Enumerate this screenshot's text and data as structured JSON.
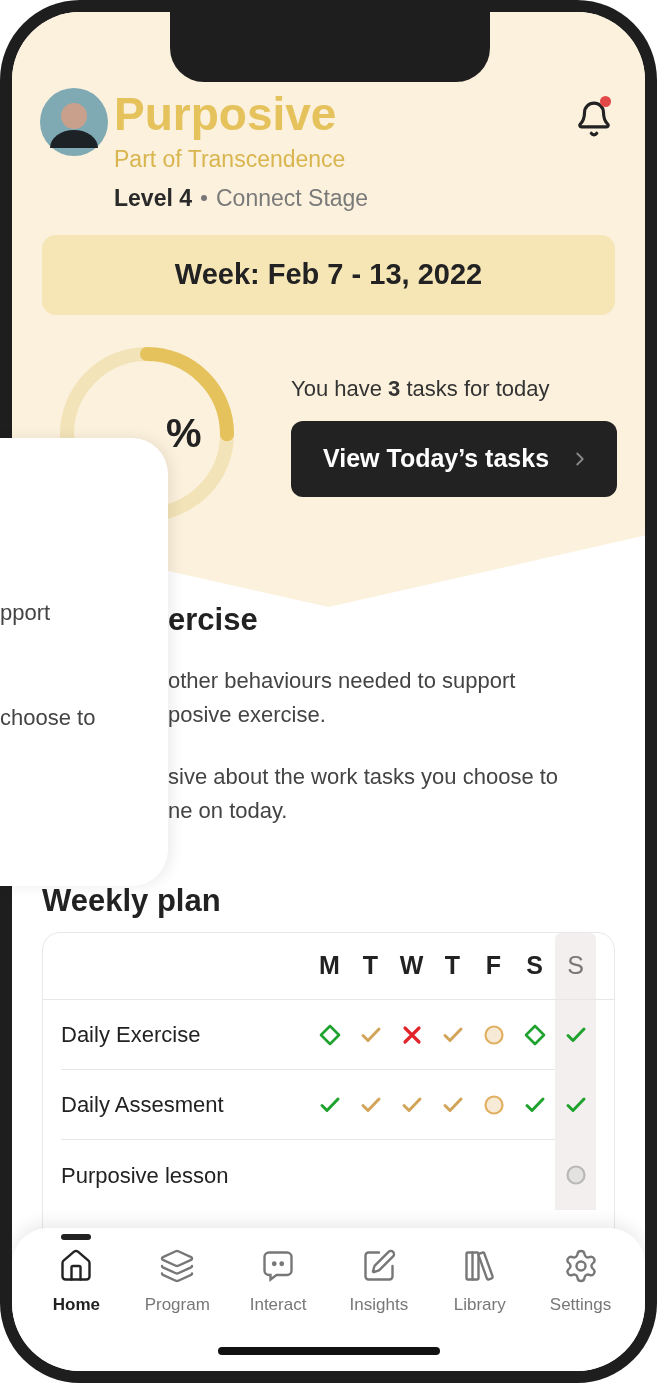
{
  "header": {
    "title": "Purposive",
    "subtitle": "Part of Transcendence",
    "level": "Level 4",
    "stage": "Connect Stage",
    "notification": true
  },
  "week": "Week: Feb 7 - 13, 2022",
  "progress": {
    "level": 0.25,
    "text": "%"
  },
  "tasks": {
    "text": "You have **3** tasks for today",
    "button": "View Today’s tasks"
  },
  "exercise": {
    "heading": "ercise",
    "paragraphs": [
      "other behaviours needed to support",
      "posive exercise.",
      "sive about the work tasks you choose to",
      "ne on today."
    ]
  },
  "overlay_card": {
    "lines": [
      "pport",
      "choose to"
    ]
  },
  "weekly_plan": {
    "heading": "Weekly plan",
    "days": [
      {
        "label": "M",
        "selected": false
      },
      {
        "label": "T",
        "selected": false
      },
      {
        "label": "W",
        "selected": false
      },
      {
        "label": "T",
        "selected": false
      },
      {
        "label": "F",
        "selected": false
      },
      {
        "label": "S",
        "selected": false
      },
      {
        "label": "S",
        "selected": true
      }
    ],
    "rows": [
      {
        "label": "Daily Exercise",
        "marks": [
          {
            "kind": "diamond",
            "color": "#1fa32e"
          },
          {
            "kind": "check",
            "color": "#d2a45a"
          },
          {
            "kind": "cross",
            "color": "#e0252b"
          },
          {
            "kind": "check",
            "color": "#d2a45a"
          },
          {
            "kind": "circle",
            "color": "#e0b060"
          },
          {
            "kind": "diamond",
            "color": "#1fa32e"
          },
          {
            "kind": "check",
            "color": "#1fa32e"
          }
        ]
      },
      {
        "label": "Daily Assesment",
        "marks": [
          {
            "kind": "check",
            "color": "#1fa32e"
          },
          {
            "kind": "check",
            "color": "#d2a45a"
          },
          {
            "kind": "check",
            "color": "#d2a45a"
          },
          {
            "kind": "check",
            "color": "#d2a45a"
          },
          {
            "kind": "circle",
            "color": "#e0b060"
          },
          {
            "kind": "check",
            "color": "#1fa32e"
          },
          {
            "kind": "check",
            "color": "#1fa32e"
          }
        ]
      },
      {
        "label": "Purposive lesson",
        "marks": [
          {
            "kind": "blank"
          },
          {
            "kind": "blank"
          },
          {
            "kind": "blank"
          },
          {
            "kind": "blank"
          },
          {
            "kind": "blank"
          },
          {
            "kind": "blank"
          },
          {
            "kind": "circle",
            "color": "#b8b8b8"
          }
        ]
      }
    ]
  },
  "nav": [
    {
      "label": "Home",
      "kind": "home",
      "selected": true
    },
    {
      "label": "Program",
      "kind": "layers",
      "selected": false
    },
    {
      "label": "Interact",
      "kind": "chat",
      "selected": false
    },
    {
      "label": "Insights",
      "kind": "note",
      "selected": false
    },
    {
      "label": "Library",
      "kind": "books",
      "selected": false
    },
    {
      "label": "Settings",
      "kind": "gear",
      "selected": false
    }
  ]
}
